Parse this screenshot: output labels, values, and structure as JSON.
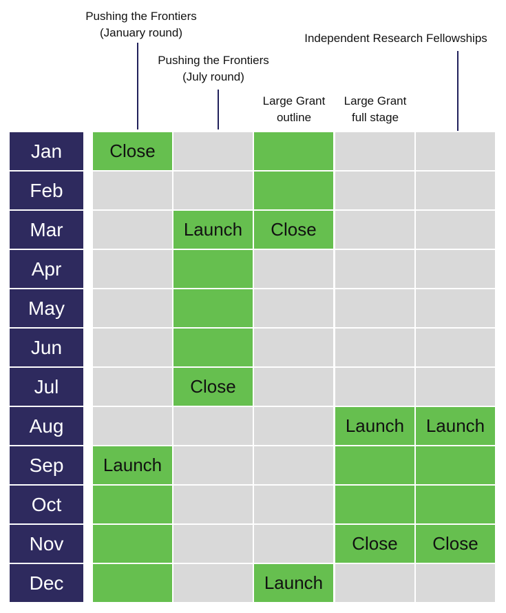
{
  "colors": {
    "active": "#66bf4f",
    "inactive": "#d9d9d9",
    "month": "#2e2a5e",
    "line": "#1f1f5a"
  },
  "months": [
    "Jan",
    "Feb",
    "Mar",
    "Apr",
    "May",
    "Jun",
    "Jul",
    "Aug",
    "Sep",
    "Oct",
    "Nov",
    "Dec"
  ],
  "columns": [
    {
      "header": [
        "Pushing the Frontiers",
        "(January round)"
      ],
      "active": [
        true,
        false,
        false,
        false,
        false,
        false,
        false,
        false,
        true,
        true,
        true,
        true
      ],
      "labels": [
        "Close",
        "",
        "",
        "",
        "",
        "",
        "",
        "",
        "Launch",
        "",
        "",
        ""
      ]
    },
    {
      "header": [
        "Pushing the Frontiers",
        "(July round)"
      ],
      "active": [
        false,
        false,
        true,
        true,
        true,
        true,
        true,
        false,
        false,
        false,
        false,
        false
      ],
      "labels": [
        "",
        "",
        "Launch",
        "",
        "",
        "",
        "Close",
        "",
        "",
        "",
        "",
        ""
      ]
    },
    {
      "header": [
        "Large Grant",
        "outline"
      ],
      "active": [
        true,
        true,
        true,
        false,
        false,
        false,
        false,
        false,
        false,
        false,
        false,
        true
      ],
      "labels": [
        "",
        "",
        "Close",
        "",
        "",
        "",
        "",
        "",
        "",
        "",
        "",
        "Launch"
      ]
    },
    {
      "header": [
        "Large Grant",
        "full stage"
      ],
      "active": [
        false,
        false,
        false,
        false,
        false,
        false,
        false,
        true,
        true,
        true,
        true,
        false
      ],
      "labels": [
        "",
        "",
        "",
        "",
        "",
        "",
        "",
        "Launch",
        "",
        "",
        "Close",
        ""
      ]
    },
    {
      "header": [
        "Independent Research Fellowships"
      ],
      "active": [
        false,
        false,
        false,
        false,
        false,
        false,
        false,
        true,
        true,
        true,
        true,
        false
      ],
      "labels": [
        "",
        "",
        "",
        "",
        "",
        "",
        "",
        "Launch",
        "",
        "",
        "Close",
        ""
      ]
    }
  ]
}
